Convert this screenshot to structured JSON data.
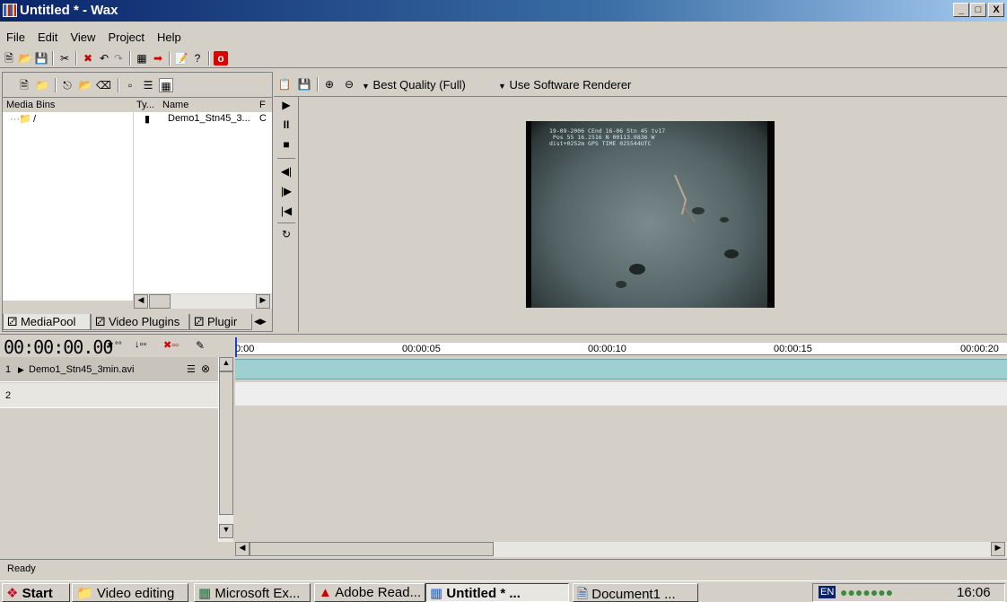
{
  "window": {
    "title": "Untitled * - Wax",
    "controls": [
      "_",
      "□",
      "X"
    ]
  },
  "menu": [
    "File",
    "Edit",
    "View",
    "Project",
    "Help"
  ],
  "media_pool": {
    "headers": {
      "bins": "Media Bins",
      "type": "Ty...",
      "name": "Name",
      "f": "F"
    },
    "bin_root": "/",
    "items": [
      {
        "type_icon": "film-icon",
        "name": "Demo1_Stn45_3...",
        "extra": "C"
      }
    ],
    "tabs": [
      "MediaPool",
      "Video Plugins",
      "Plugir"
    ]
  },
  "preview": {
    "quality": "Best Quality (Full)",
    "renderer": "Use Software Renderer",
    "overlay": "19-09-2006 CEnd 16-06 Stn 45 tv17\n Pos 55 16.2516 N 00113.0836 W\ndist+0252m GPS TIME 025544UTC"
  },
  "timeline": {
    "timecode": "00:00:00.00",
    "ruler_labels": [
      "0:00",
      "00:00:05",
      "00:00:10",
      "00:00:15",
      "00:00:20"
    ],
    "tracks": [
      {
        "number": "1",
        "name": "Demo1_Stn45_3min.avi"
      },
      {
        "number": "2",
        "name": ""
      }
    ]
  },
  "status": "Ready",
  "taskbar": {
    "start": "Start",
    "tasks": [
      "Video editing",
      "Microsoft Ex...",
      "Adobe Read...",
      "Untitled * ...",
      "Document1 ..."
    ],
    "lang": "EN",
    "clock": "16:06"
  },
  "colors": {
    "titlebar": "#0a246a",
    "track_clip": "#9ecfd1",
    "chrome": "#d4d0c8"
  }
}
